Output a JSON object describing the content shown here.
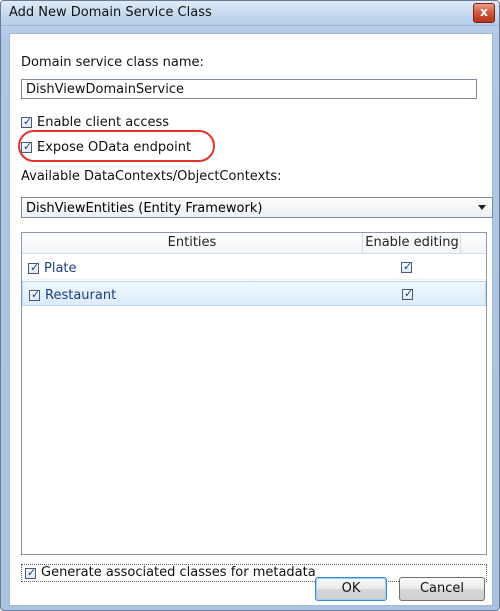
{
  "window": {
    "title": "Add New Domain Service Class",
    "close_symbol": "x"
  },
  "form": {
    "domain_service_class_label": "Domain service class name:",
    "domain_service_class_value": "DishViewDomainService",
    "enable_client_access_label": "Enable client access",
    "enable_client_access_checked": true,
    "expose_odata_label": "Expose OData endpoint",
    "expose_odata_checked": true,
    "available_contexts_label": "Available DataContexts/ObjectContexts:",
    "selected_context": "DishViewEntities (Entity Framework)",
    "generate_metadata_label": "Generate associated classes for metadata",
    "generate_metadata_checked": true
  },
  "grid": {
    "columns": [
      "Entities",
      "Enable editing",
      ""
    ],
    "rows": [
      {
        "entity": "Plate",
        "entity_checked": true,
        "editing_checked": true
      },
      {
        "entity": "Restaurant",
        "entity_checked": true,
        "editing_checked": true
      }
    ]
  },
  "buttons": {
    "ok_label": "OK",
    "cancel_label": "Cancel"
  },
  "colors": {
    "highlight": "#e6322e",
    "selected_row": "#dcebfb",
    "titlebar": "#c6d9ef"
  },
  "icons": {
    "close": "close-icon",
    "checkbox": "checkbox-icon",
    "dropdown": "chevron-down-icon"
  }
}
